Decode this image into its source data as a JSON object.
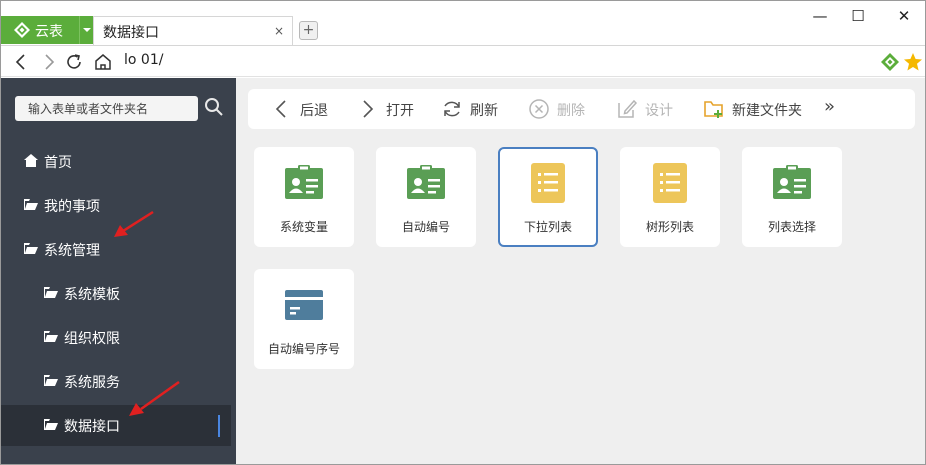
{
  "titlebar": {
    "brand_label": "云表",
    "tab_label": "数据接口",
    "tab_close": "×",
    "new_tab": "+",
    "min": "—",
    "max": "☐",
    "close": "✕"
  },
  "address": {
    "url": "lo              01/"
  },
  "sidebar": {
    "search_placeholder": "输入表单或者文件夹名",
    "items": [
      {
        "label": "首页"
      },
      {
        "label": "我的事项"
      },
      {
        "label": "系统管理"
      },
      {
        "label": "系统模板"
      },
      {
        "label": "组织权限"
      },
      {
        "label": "系统服务"
      },
      {
        "label": "数据接口"
      }
    ]
  },
  "toolbar": {
    "back": "后退",
    "open": "打开",
    "refresh": "刷新",
    "delete": "删除",
    "design": "设计",
    "new_folder": "新建文件夹",
    "more": "»"
  },
  "cards": [
    {
      "label": "系统变量",
      "icon": "green-badge-icon"
    },
    {
      "label": "自动编号",
      "icon": "green-badge-icon"
    },
    {
      "label": "下拉列表",
      "icon": "yellow-list-icon"
    },
    {
      "label": "树形列表",
      "icon": "yellow-list-icon"
    },
    {
      "label": "列表选择",
      "icon": "green-badge-icon"
    },
    {
      "label": "自动编号序号",
      "icon": "blue-card-icon"
    }
  ],
  "colors": {
    "brand_green": "#5bad3b",
    "sidebar_bg": "#3a414c",
    "active_blue": "#4a86e0",
    "card_green": "#5a9e55",
    "card_yellow": "#edc65a",
    "card_blue": "#4f7d9c",
    "arrow_red": "#e02020"
  }
}
